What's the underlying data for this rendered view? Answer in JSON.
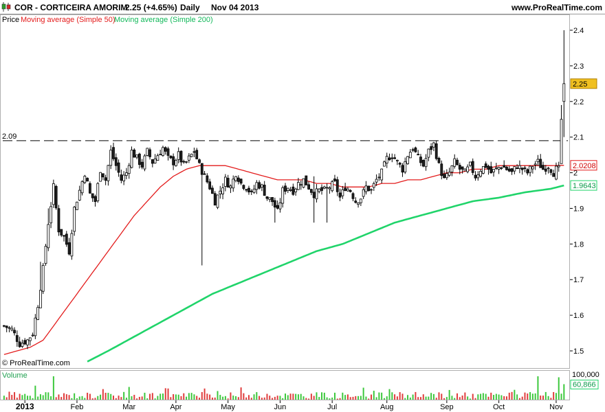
{
  "header": {
    "title": "COR - CORTICEIRA AMORIM",
    "change": "2.25 (+4.65%)",
    "period": "Daily",
    "date": "Nov 04 2013",
    "site": "www.ProRealTime.com"
  },
  "legend": {
    "price": "Price",
    "ma50": "Moving average (Simple 50)",
    "ma200": "Moving average (Simple 200)"
  },
  "watermark": "© ProRealTime.com",
  "volume_label": "Volume",
  "colors": {
    "ma50": "#e31b1b",
    "ma200": "#20d46a",
    "up_volume": "#3cc83c",
    "down_volume": "#e03c3c",
    "last_price_tag": "#f0c020"
  },
  "chart_data": {
    "type": "candlestick",
    "y_scale": {
      "min": 1.5,
      "max": 2.4,
      "ticks": [
        "2.4",
        "2.3",
        "2.2",
        "2.1",
        "2",
        "1.9",
        "1.8",
        "1.7",
        "1.6",
        "1.5"
      ],
      "tick_values": [
        2.4,
        2.3,
        2.2,
        2.1,
        2.0,
        1.9,
        1.8,
        1.7,
        1.6,
        1.5
      ]
    },
    "x_labels": [
      "2013",
      "Feb",
      "Mar",
      "Apr",
      "May",
      "Jun",
      "Jul",
      "Aug",
      "Sep",
      "Oct",
      "Nov"
    ],
    "x_label_index": [
      8,
      28,
      48,
      66,
      86,
      106,
      126,
      147,
      170,
      190,
      212
    ],
    "resistance_line": {
      "value": 2.09,
      "label": "2.09"
    },
    "last_values": {
      "price": "2.25",
      "ma50": "2.0208",
      "ma200": "1.9643"
    },
    "volume_axis": {
      "top_label": "100,000",
      "last_label": "60,866",
      "top_value": 100000,
      "last_value": 60866
    },
    "series": [
      {
        "name": "Price",
        "close_path": [
          [
            0,
            1.57
          ],
          [
            3,
            1.56
          ],
          [
            6,
            1.52
          ],
          [
            9,
            1.53
          ],
          [
            11,
            1.55
          ],
          [
            13,
            1.63
          ],
          [
            15,
            1.73
          ],
          [
            17,
            1.86
          ],
          [
            19,
            1.96
          ],
          [
            21,
            1.84
          ],
          [
            23,
            1.82
          ],
          [
            25,
            1.78
          ],
          [
            27,
            1.9
          ],
          [
            29,
            1.95
          ],
          [
            31,
            2.0
          ],
          [
            33,
            1.94
          ],
          [
            35,
            1.92
          ],
          [
            37,
            2.01
          ],
          [
            39,
            1.98
          ],
          [
            41,
            2.06
          ],
          [
            43,
            2.02
          ],
          [
            45,
            1.98
          ],
          [
            47,
            2.0
          ],
          [
            49,
            2.06
          ],
          [
            51,
            2.04
          ],
          [
            53,
            2.02
          ],
          [
            55,
            2.06
          ],
          [
            57,
            2.03
          ],
          [
            59,
            2.05
          ],
          [
            61,
            2.07
          ],
          [
            63,
            2.04
          ],
          [
            65,
            2.03
          ],
          [
            67,
            2.05
          ],
          [
            69,
            2.02
          ],
          [
            71,
            2.04
          ],
          [
            73,
            2.06
          ],
          [
            75,
            2.02
          ],
          [
            77,
            1.99
          ],
          [
            79,
            1.96
          ],
          [
            81,
            1.92
          ],
          [
            83,
            1.95
          ],
          [
            85,
            1.98
          ],
          [
            87,
            1.96
          ],
          [
            89,
            2.0
          ],
          [
            91,
            1.97
          ],
          [
            93,
            1.96
          ],
          [
            95,
            1.94
          ],
          [
            97,
            1.97
          ],
          [
            99,
            1.96
          ],
          [
            101,
            1.93
          ],
          [
            103,
            1.92
          ],
          [
            105,
            1.89
          ],
          [
            107,
            1.95
          ],
          [
            109,
            1.96
          ],
          [
            111,
            1.95
          ],
          [
            113,
            1.97
          ],
          [
            115,
            1.98
          ],
          [
            117,
            1.96
          ],
          [
            119,
            1.94
          ],
          [
            121,
            1.95
          ],
          [
            123,
            1.95
          ],
          [
            125,
            1.96
          ],
          [
            127,
            1.97
          ],
          [
            129,
            1.93
          ],
          [
            131,
            1.96
          ],
          [
            133,
            1.95
          ],
          [
            135,
            1.92
          ],
          [
            137,
            1.93
          ],
          [
            139,
            1.96
          ],
          [
            141,
            1.95
          ],
          [
            143,
            1.98
          ],
          [
            145,
            2.0
          ],
          [
            147,
            2.04
          ],
          [
            149,
            2.05
          ],
          [
            151,
            2.03
          ],
          [
            153,
            2.01
          ],
          [
            155,
            2.05
          ],
          [
            157,
            2.07
          ],
          [
            159,
            2.04
          ],
          [
            161,
            2.02
          ],
          [
            163,
            2.06
          ],
          [
            165,
            2.08
          ],
          [
            167,
            2.02
          ],
          [
            169,
            1.98
          ],
          [
            171,
            2.0
          ],
          [
            173,
            2.03
          ],
          [
            175,
            2.01
          ],
          [
            177,
            2.0
          ],
          [
            179,
            2.02
          ],
          [
            181,
            1.99
          ],
          [
            183,
            2.01
          ],
          [
            185,
            2.02
          ],
          [
            187,
            2.0
          ],
          [
            189,
            2.01
          ],
          [
            191,
            2.02
          ],
          [
            193,
            2.01
          ],
          [
            195,
            2.0
          ],
          [
            197,
            2.02
          ],
          [
            199,
            2.01
          ],
          [
            201,
            2.0
          ],
          [
            203,
            2.02
          ],
          [
            205,
            2.03
          ],
          [
            207,
            2.01
          ],
          [
            209,
            2.02
          ],
          [
            211,
            2.0
          ],
          [
            213,
            2.02
          ],
          [
            214,
            2.15
          ],
          [
            215,
            2.25
          ]
        ],
        "values": [
          {
            "index": 14,
            "high": 1.75,
            "low": 1.66
          },
          {
            "index": 17,
            "high": 1.9,
            "low": 1.78
          },
          {
            "index": 76,
            "high": 2.0,
            "low": 1.74
          },
          {
            "index": 104,
            "high": 1.93,
            "low": 1.86
          },
          {
            "index": 119,
            "high": 1.99,
            "low": 1.86
          },
          {
            "index": 124,
            "high": 1.97,
            "low": 1.86
          },
          {
            "index": 214,
            "high": 2.19,
            "low": 2.08
          },
          {
            "index": 215,
            "high": 2.4,
            "low": 2.1
          }
        ]
      },
      {
        "name": "Moving average (Simple 50)",
        "points": [
          [
            0,
            1.49
          ],
          [
            5,
            1.5
          ],
          [
            10,
            1.51
          ],
          [
            15,
            1.53
          ],
          [
            20,
            1.58
          ],
          [
            25,
            1.63
          ],
          [
            30,
            1.68
          ],
          [
            35,
            1.73
          ],
          [
            40,
            1.78
          ],
          [
            45,
            1.83
          ],
          [
            50,
            1.88
          ],
          [
            55,
            1.92
          ],
          [
            60,
            1.96
          ],
          [
            65,
            1.99
          ],
          [
            70,
            2.01
          ],
          [
            75,
            2.02
          ],
          [
            80,
            2.02
          ],
          [
            85,
            2.02
          ],
          [
            90,
            2.01
          ],
          [
            95,
            2.0
          ],
          [
            100,
            1.99
          ],
          [
            105,
            1.98
          ],
          [
            110,
            1.98
          ],
          [
            115,
            1.98
          ],
          [
            120,
            1.97
          ],
          [
            125,
            1.97
          ],
          [
            130,
            1.96
          ],
          [
            135,
            1.96
          ],
          [
            140,
            1.96
          ],
          [
            145,
            1.97
          ],
          [
            150,
            1.97
          ],
          [
            155,
            1.98
          ],
          [
            160,
            1.98
          ],
          [
            165,
            1.99
          ],
          [
            170,
            2.0
          ],
          [
            175,
            2.0
          ],
          [
            180,
            2.01
          ],
          [
            185,
            2.01
          ],
          [
            190,
            2.02
          ],
          [
            195,
            2.02
          ],
          [
            200,
            2.02
          ],
          [
            205,
            2.02
          ],
          [
            210,
            2.02
          ],
          [
            215,
            2.0208
          ]
        ]
      },
      {
        "name": "Moving average (Simple 200)",
        "points": [
          [
            32,
            1.47
          ],
          [
            40,
            1.5
          ],
          [
            50,
            1.54
          ],
          [
            60,
            1.58
          ],
          [
            70,
            1.62
          ],
          [
            80,
            1.66
          ],
          [
            90,
            1.69
          ],
          [
            100,
            1.72
          ],
          [
            110,
            1.75
          ],
          [
            120,
            1.78
          ],
          [
            130,
            1.8
          ],
          [
            140,
            1.83
          ],
          [
            150,
            1.86
          ],
          [
            160,
            1.88
          ],
          [
            170,
            1.9
          ],
          [
            180,
            1.92
          ],
          [
            190,
            1.93
          ],
          [
            200,
            1.945
          ],
          [
            210,
            1.955
          ],
          [
            215,
            1.9643
          ]
        ]
      },
      {
        "name": "Volume",
        "values": [
          {
            "index": 12,
            "value": 55000
          },
          {
            "index": 19,
            "value": 92000
          },
          {
            "index": 48,
            "value": 50000
          },
          {
            "index": 62,
            "value": 45000
          },
          {
            "index": 142,
            "value": 35000
          },
          {
            "index": 171,
            "value": 38000
          },
          {
            "index": 205,
            "value": 92000
          },
          {
            "index": 213,
            "value": 88000
          },
          {
            "index": 215,
            "value": 60866
          }
        ]
      }
    ]
  }
}
